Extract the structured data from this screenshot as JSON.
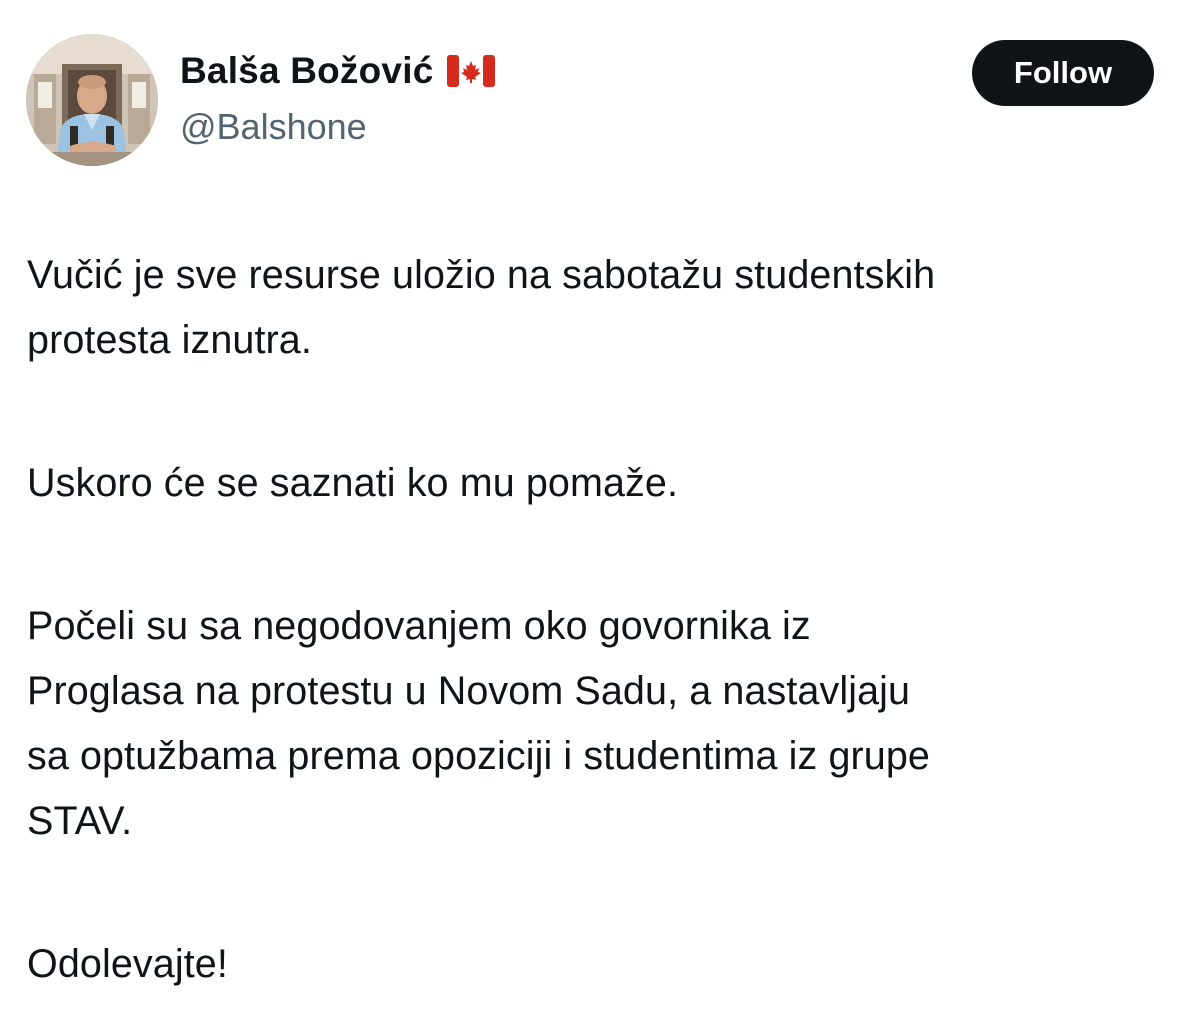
{
  "author": {
    "display_name": "Balša Božović",
    "handle": "@Balshone",
    "flag_icon": "canada-flag-icon",
    "avatar_icon": "profile-photo"
  },
  "follow_button": {
    "label": "Follow"
  },
  "tweet": {
    "paragraphs": [
      "Vučić je sve resurse uložio na sabotažu studentskih\nprotesta iznutra.",
      "Uskoro će se saznati ko mu pomaže.",
      "Počeli su sa negodovanjem oko govornika iz\nProglasa na protestu u Novom Sadu, a nastavljaju\nsa optužbama prema opoziciji i studentima iz grupe\nSTAV.",
      "Odolevajte!"
    ]
  },
  "colors": {
    "text": "#0f1419",
    "secondary_text": "#536471",
    "button_bg": "#0f1419",
    "button_text": "#ffffff",
    "flag_red": "#d52b1e"
  }
}
